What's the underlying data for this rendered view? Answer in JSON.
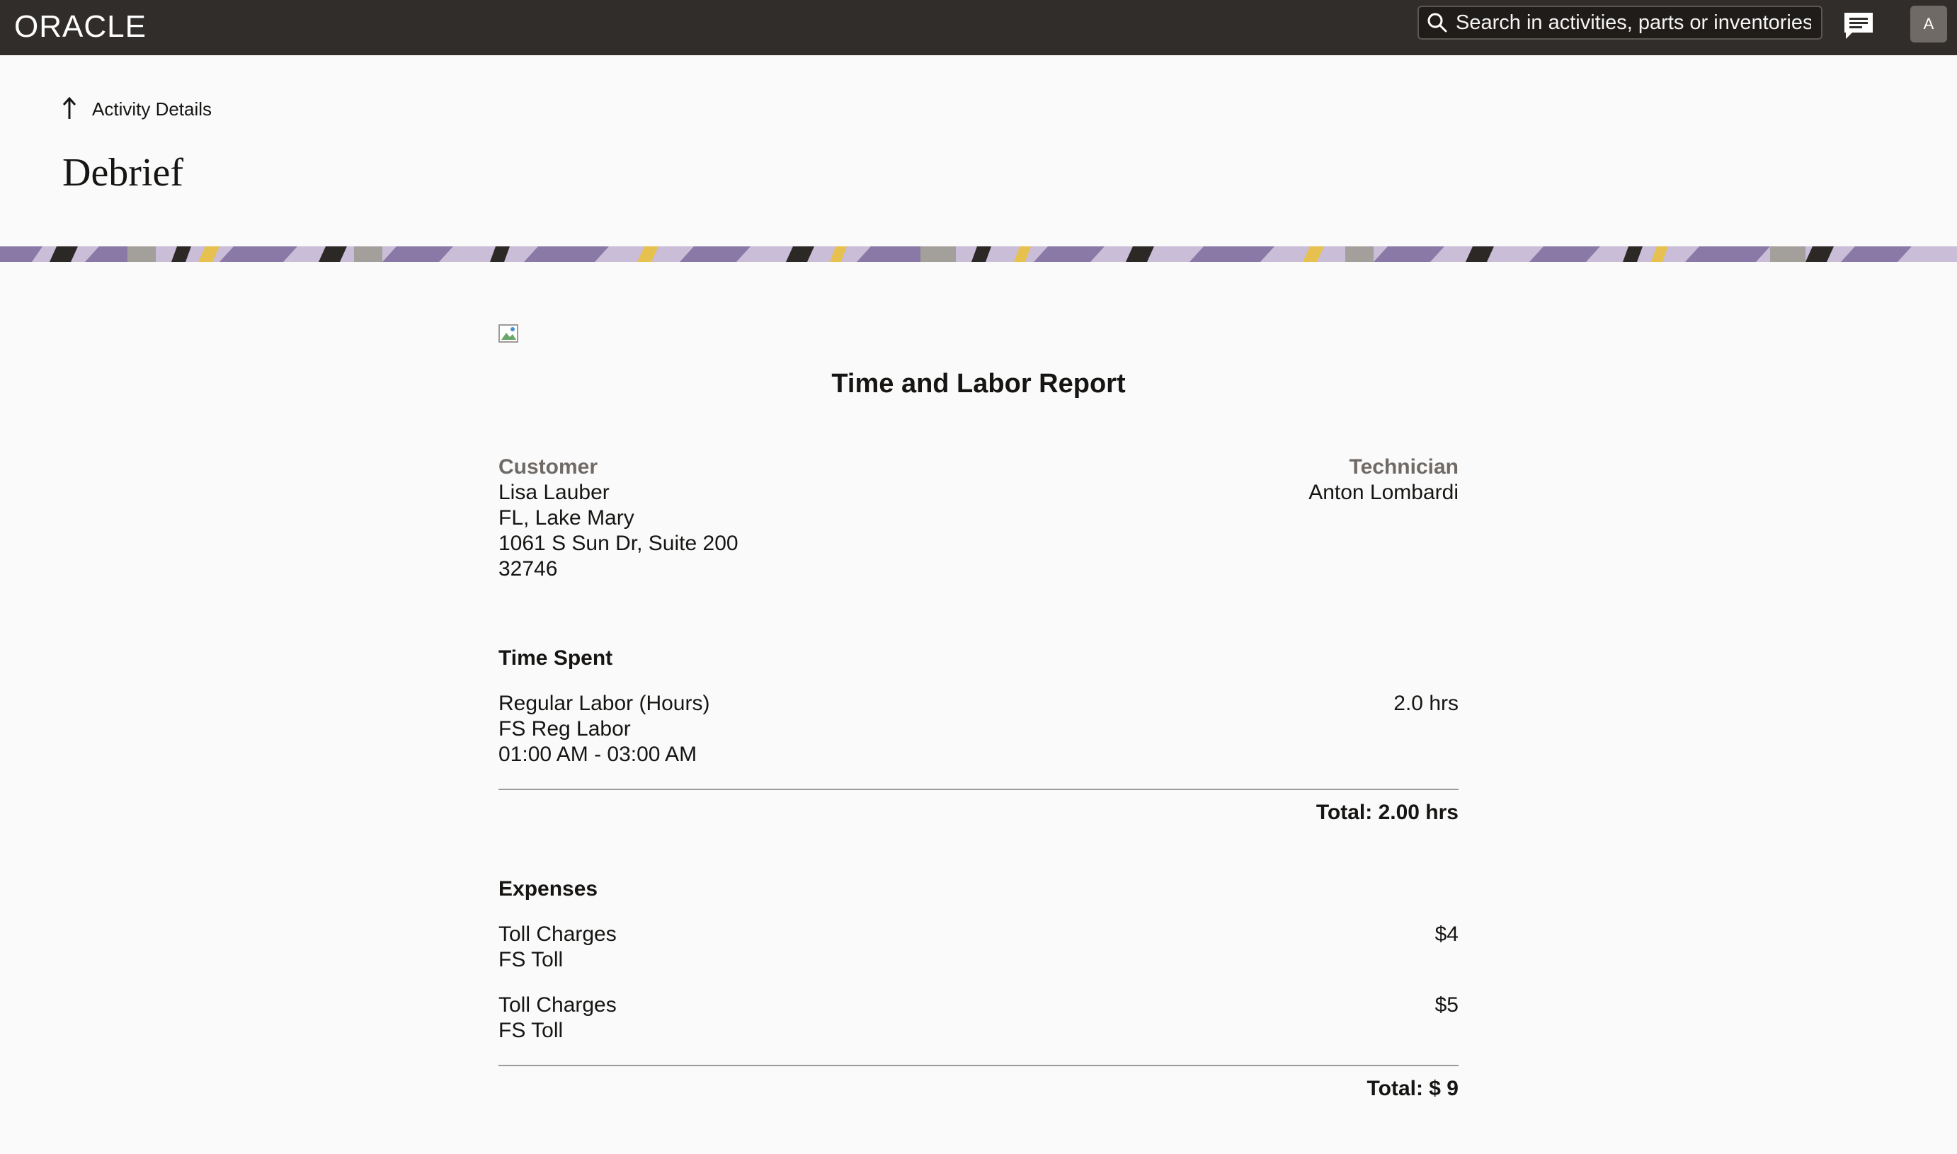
{
  "header": {
    "logo": "ORACLE",
    "search": {
      "placeholder": "Search in activities, parts or inventories",
      "value": ""
    },
    "avatar_initial": "A"
  },
  "page": {
    "back_label": "Activity Details",
    "title": "Debrief"
  },
  "report": {
    "title": "Time and Labor Report",
    "customer": {
      "heading": "Customer",
      "name": "Lisa Lauber",
      "city": "FL, Lake Mary",
      "address": "1061 S Sun Dr, Suite 200",
      "zip": "32746"
    },
    "technician": {
      "heading": "Technician",
      "name": "Anton Lombardi"
    },
    "time_spent": {
      "heading": "Time Spent",
      "items": [
        {
          "type": "Regular Labor (Hours)",
          "item": "FS Reg Labor",
          "range": "01:00 AM - 03:00 AM",
          "value": "2.0 hrs"
        }
      ],
      "total": "Total: 2.00 hrs"
    },
    "expenses": {
      "heading": "Expenses",
      "items": [
        {
          "type": "Toll Charges",
          "item": "FS Toll",
          "value": "$4"
        },
        {
          "type": "Toll Charges",
          "item": "FS Toll",
          "value": "$5"
        }
      ],
      "total": "Total: $ 9"
    }
  },
  "colors": {
    "topbar": "#312d2a",
    "background": "#fafafa",
    "muted_heading": "#6f6a66",
    "band_purple": "#8a79a6",
    "band_gold": "#e7c14f",
    "band_dark": "#2b2826"
  }
}
